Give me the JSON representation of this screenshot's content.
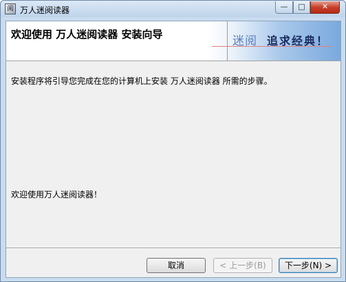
{
  "window": {
    "title": "万人迷阅读器",
    "icon_text": "阅",
    "controls": {
      "minimize": "—",
      "maximize": "□",
      "close": "✕"
    }
  },
  "header": {
    "title": "欢迎使用  万人迷阅读器  安装向导",
    "banner_brand": "迷阅",
    "banner_slogan": "追求经典！"
  },
  "body": {
    "intro": "安装程序将引导您完成在您的计算机上安装 万人迷阅读器 所需的步骤。",
    "welcome": "欢迎使用万人迷阅读器！"
  },
  "buttons": {
    "cancel": "取消",
    "back": "< 上一步(B)",
    "next": "下一步(N) >"
  }
}
